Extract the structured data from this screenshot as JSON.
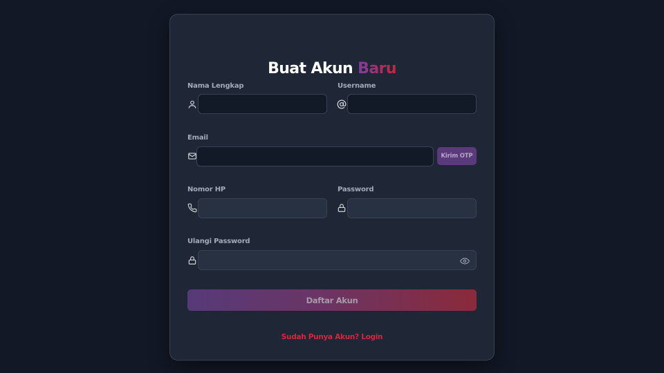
{
  "form": {
    "title_main": "Buat Akun ",
    "title_accent": "Baru",
    "fields": {
      "nama": {
        "label": "Nama Lengkap",
        "value": "",
        "icon": "user-icon"
      },
      "username": {
        "label": "Username",
        "value": "",
        "icon": "at-icon"
      },
      "email": {
        "label": "Email",
        "value": "",
        "icon": "mail-icon"
      },
      "nomor_hp": {
        "label": "Nomor HP",
        "value": "",
        "icon": "phone-icon"
      },
      "password": {
        "label": "Password",
        "value": "",
        "icon": "lock-icon"
      },
      "ulangi_password": {
        "label": "Ulangi Password",
        "value": "",
        "icon": "lock-icon"
      }
    },
    "otp_button": "Kirim OTP",
    "submit_label": "Daftar Akun",
    "login_link": "Sudah Punya Akun? Login"
  },
  "colors": {
    "background": "#121826",
    "card": "#1f2736",
    "accent_start": "#7b3fa0",
    "accent_end": "#c8243c",
    "link": "#d4263c"
  }
}
